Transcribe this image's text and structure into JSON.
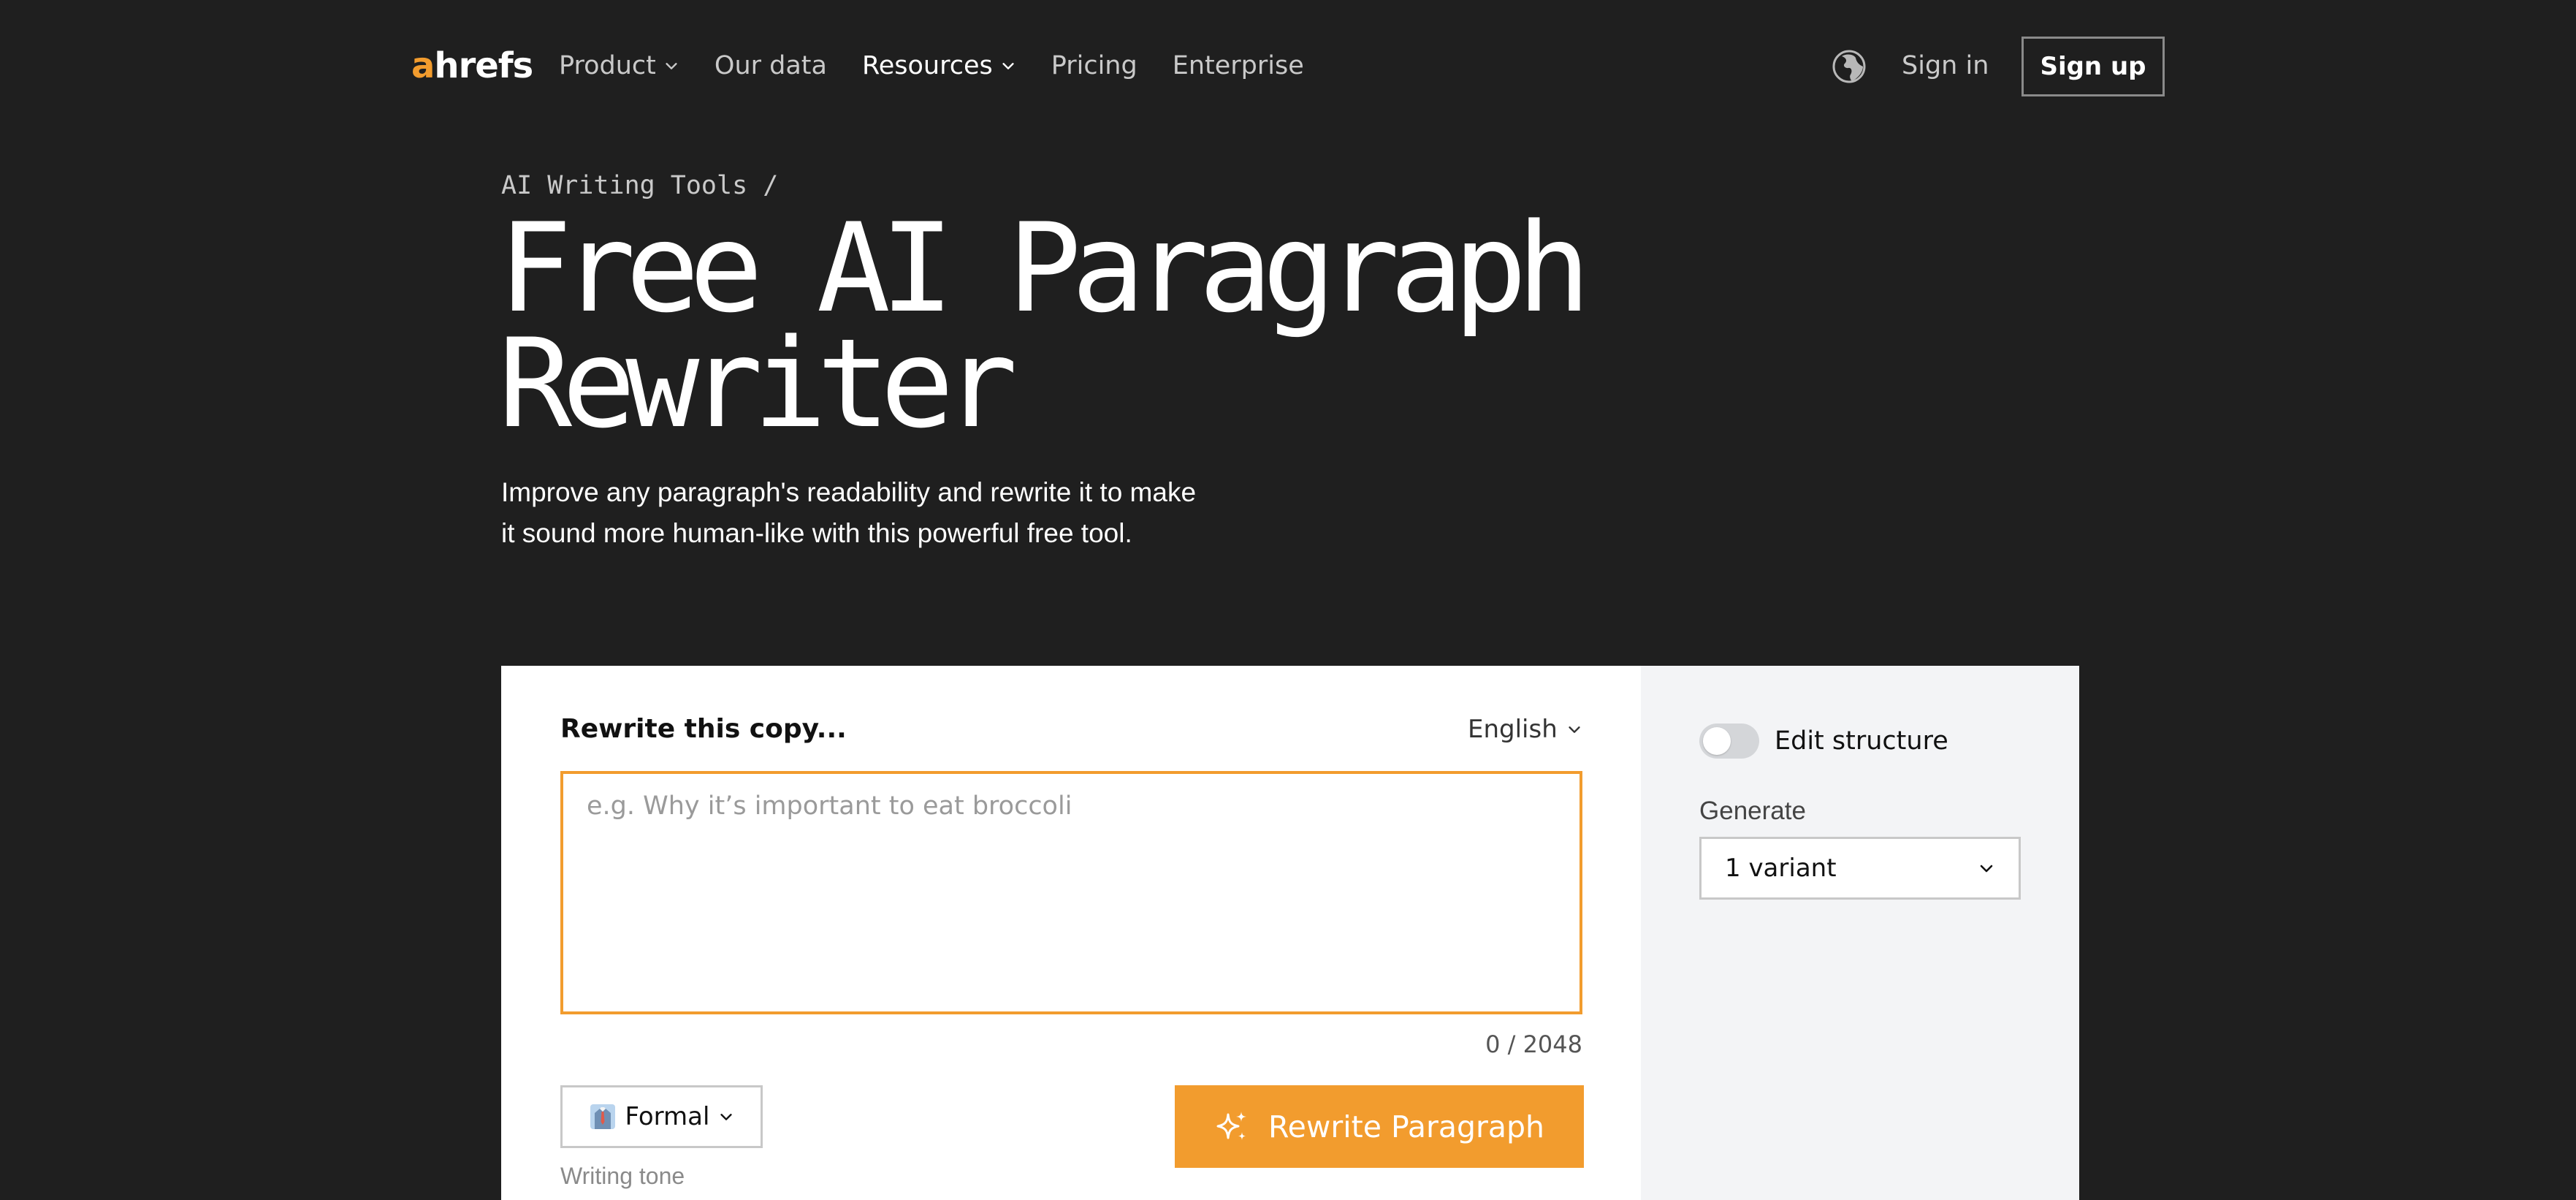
{
  "nav": {
    "logo_accent": "a",
    "logo_rest": "hrefs",
    "links": [
      {
        "label": "Product",
        "has_dropdown": true
      },
      {
        "label": "Our data",
        "has_dropdown": false
      },
      {
        "label": "Resources",
        "has_dropdown": true
      },
      {
        "label": "Pricing",
        "has_dropdown": false
      },
      {
        "label": "Enterprise",
        "has_dropdown": false
      }
    ],
    "language_icon": "globe-icon",
    "signin": "Sign in",
    "signup": "Sign up"
  },
  "hero": {
    "breadcrumb_link": "AI Writing Tools",
    "breadcrumb_sep": "/",
    "title_line1": "Free AI Paragraph",
    "title_line2": "Rewriter",
    "subtitle": "Improve any paragraph's readability and rewrite it to make it sound more human-like with this powerful free tool."
  },
  "tool": {
    "input_label": "Rewrite this copy...",
    "language": "English",
    "input_value": "",
    "input_placeholder": "e.g. Why it’s important to eat broccoli",
    "char_count": "0 / 2048",
    "tone": "Formal",
    "tone_icon": "necktie-shirt-icon",
    "tone_caption": "Writing tone",
    "submit_label": "Rewrite Paragraph",
    "submit_icon": "sparkles-icon"
  },
  "options": {
    "edit_structure_label": "Edit structure",
    "edit_structure_enabled": false,
    "generate_label": "Generate",
    "variant_selected": "1 variant"
  },
  "colors": {
    "background": "#1f1f1f",
    "accent": "#f29c2e",
    "card": "#ffffff",
    "side_panel": "#f3f4f6"
  }
}
